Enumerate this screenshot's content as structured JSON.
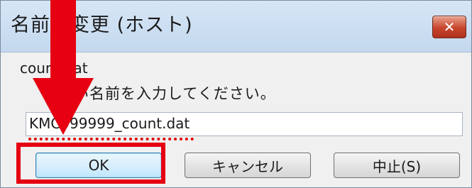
{
  "dialog": {
    "title": "名前の変更 (ホスト)",
    "filename": "count.dat",
    "prompt": "新しい名前を入力してください。",
    "input_value": "KMC999999_count.dat"
  },
  "buttons": {
    "ok": "OK",
    "cancel": "キャンセル",
    "abort": "中止(S)"
  },
  "icons": {
    "close": "close-icon",
    "annotation_arrow": "down-arrow-icon"
  },
  "colors": {
    "annotation": "#e60012",
    "close_button": "#c7452c",
    "titlebar": "#c9dcf0"
  }
}
